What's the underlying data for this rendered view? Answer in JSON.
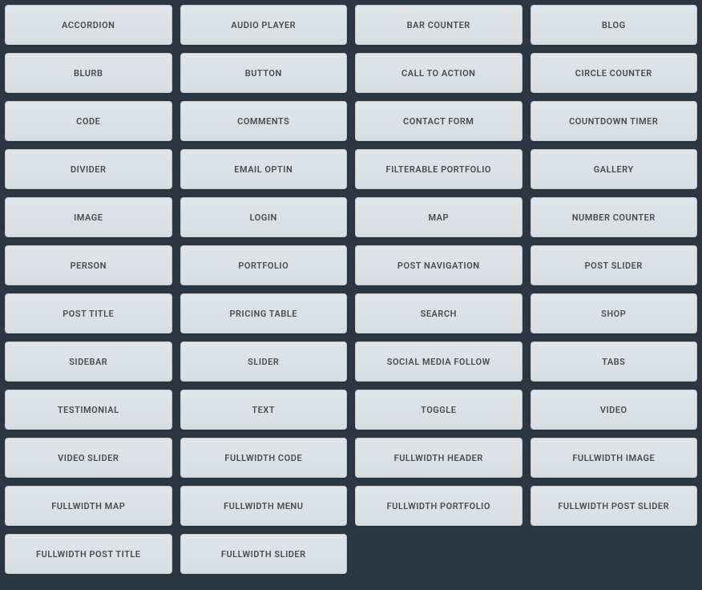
{
  "modules": [
    {
      "label": "ACCORDION",
      "name": "accordion"
    },
    {
      "label": "AUDIO PLAYER",
      "name": "audio-player"
    },
    {
      "label": "BAR COUNTER",
      "name": "bar-counter"
    },
    {
      "label": "BLOG",
      "name": "blog"
    },
    {
      "label": "BLURB",
      "name": "blurb"
    },
    {
      "label": "BUTTON",
      "name": "button"
    },
    {
      "label": "CALL TO ACTION",
      "name": "call-to-action"
    },
    {
      "label": "CIRCLE COUNTER",
      "name": "circle-counter"
    },
    {
      "label": "CODE",
      "name": "code"
    },
    {
      "label": "COMMENTS",
      "name": "comments"
    },
    {
      "label": "CONTACT FORM",
      "name": "contact-form"
    },
    {
      "label": "COUNTDOWN TIMER",
      "name": "countdown-timer"
    },
    {
      "label": "DIVIDER",
      "name": "divider"
    },
    {
      "label": "EMAIL OPTIN",
      "name": "email-optin"
    },
    {
      "label": "FILTERABLE PORTFOLIO",
      "name": "filterable-portfolio"
    },
    {
      "label": "GALLERY",
      "name": "gallery"
    },
    {
      "label": "IMAGE",
      "name": "image"
    },
    {
      "label": "LOGIN",
      "name": "login"
    },
    {
      "label": "MAP",
      "name": "map"
    },
    {
      "label": "NUMBER COUNTER",
      "name": "number-counter"
    },
    {
      "label": "PERSON",
      "name": "person"
    },
    {
      "label": "PORTFOLIO",
      "name": "portfolio"
    },
    {
      "label": "POST NAVIGATION",
      "name": "post-navigation"
    },
    {
      "label": "POST SLIDER",
      "name": "post-slider"
    },
    {
      "label": "POST TITLE",
      "name": "post-title"
    },
    {
      "label": "PRICING TABLE",
      "name": "pricing-table"
    },
    {
      "label": "SEARCH",
      "name": "search"
    },
    {
      "label": "SHOP",
      "name": "shop"
    },
    {
      "label": "SIDEBAR",
      "name": "sidebar"
    },
    {
      "label": "SLIDER",
      "name": "slider"
    },
    {
      "label": "SOCIAL MEDIA FOLLOW",
      "name": "social-media-follow"
    },
    {
      "label": "TABS",
      "name": "tabs"
    },
    {
      "label": "TESTIMONIAL",
      "name": "testimonial"
    },
    {
      "label": "TEXT",
      "name": "text"
    },
    {
      "label": "TOGGLE",
      "name": "toggle"
    },
    {
      "label": "VIDEO",
      "name": "video"
    },
    {
      "label": "VIDEO SLIDER",
      "name": "video-slider"
    },
    {
      "label": "FULLWIDTH CODE",
      "name": "fullwidth-code"
    },
    {
      "label": "FULLWIDTH HEADER",
      "name": "fullwidth-header"
    },
    {
      "label": "FULLWIDTH IMAGE",
      "name": "fullwidth-image"
    },
    {
      "label": "FULLWIDTH MAP",
      "name": "fullwidth-map"
    },
    {
      "label": "FULLWIDTH MENU",
      "name": "fullwidth-menu"
    },
    {
      "label": "FULLWIDTH PORTFOLIO",
      "name": "fullwidth-portfolio"
    },
    {
      "label": "FULLWIDTH POST SLIDER",
      "name": "fullwidth-post-slider"
    },
    {
      "label": "FULLWIDTH POST TITLE",
      "name": "fullwidth-post-title"
    },
    {
      "label": "FULLWIDTH SLIDER",
      "name": "fullwidth-slider"
    }
  ]
}
